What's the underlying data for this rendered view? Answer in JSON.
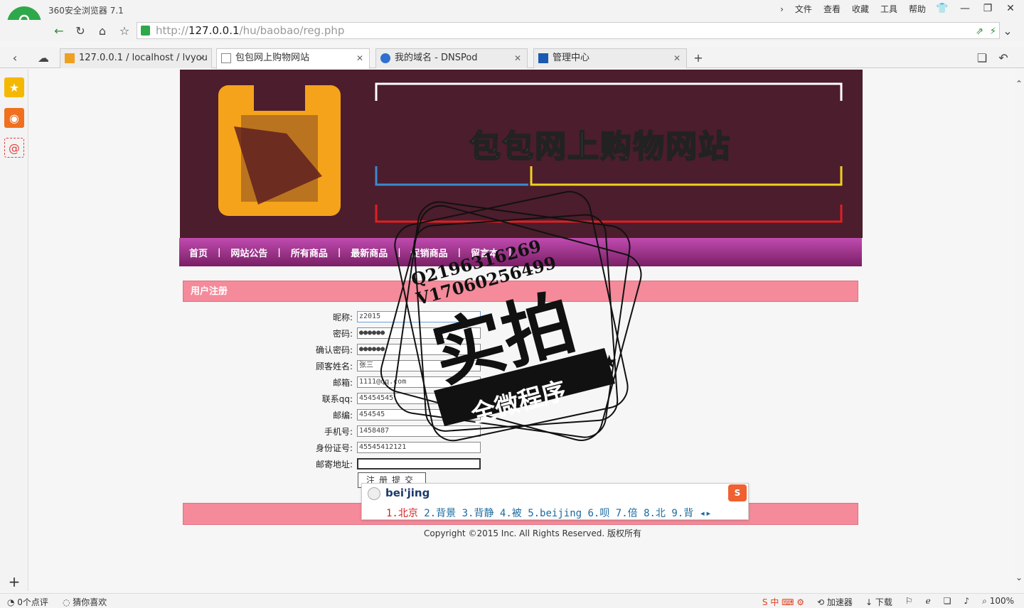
{
  "browser": {
    "title": "360安全浏览器 7.1",
    "menus": [
      "文件",
      "查看",
      "收藏",
      "工具",
      "帮助"
    ],
    "url_prefix": "http://",
    "url_host": "127.0.0.1",
    "url_path": "/hu/baobao/reg.php"
  },
  "tabs": [
    {
      "label": "127.0.0.1 / localhost / lvyou",
      "icon": "phpmyadmin-icon"
    },
    {
      "label": "包包网上购物网站",
      "icon": "page-icon",
      "active": true
    },
    {
      "label": "我的域名 - DNSPod",
      "icon": "dnspod-icon"
    },
    {
      "label": "管理中心",
      "icon": "manage-icon"
    }
  ],
  "site": {
    "banner_title": "包包网上购物网站",
    "nav": [
      "首页",
      "网站公告",
      "所有商品",
      "最新商品",
      "促销商品",
      "留言本"
    ],
    "section_title": "用户注册",
    "copyright": "Copyright ©2015 Inc. All Rights Reserved. 版权所有"
  },
  "form": {
    "fields": [
      {
        "label": "昵称:",
        "value": "z2015"
      },
      {
        "label": "密码:",
        "value": "●●●●●●"
      },
      {
        "label": "确认密码:",
        "value": "●●●●●●"
      },
      {
        "label": "顾客姓名:",
        "value": "张三"
      },
      {
        "label": "邮箱:",
        "value": "1111@qq.com"
      },
      {
        "label": "联系qq:",
        "value": "45454545"
      },
      {
        "label": "邮编:",
        "value": "454545"
      },
      {
        "label": "手机号:",
        "value": "1458487"
      },
      {
        "label": "身份证号:",
        "value": "45545412121"
      },
      {
        "label": "邮寄地址:",
        "value": ""
      }
    ],
    "submit_label": "注册提交"
  },
  "ime": {
    "pinyin": "bei'jing",
    "candidates": [
      "1.北京",
      "2.背景",
      "3.背静",
      "4.被",
      "5.beijing",
      "6.呗",
      "7.倍",
      "8.北",
      "9.背"
    ]
  },
  "watermark": {
    "line1": "Q2196316269",
    "line2": "V17060256499",
    "main": "实拍",
    "sub": "全微程序"
  },
  "status": {
    "comments": "0个点评",
    "guess": "猜你喜欢",
    "accelerator": "加速器",
    "download": "下载",
    "zoom": "100%"
  },
  "colors": {
    "banner_bg": "#4c1d2c",
    "nav_bg": "#9a2a88",
    "pink_bar": "#f48a9a",
    "logo_orange": "#f5a31a"
  }
}
